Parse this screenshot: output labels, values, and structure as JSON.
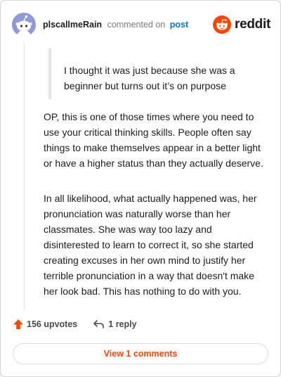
{
  "comment": {
    "username": "plscallmeRain",
    "action_text": "commented on",
    "post_link": "post",
    "quote": "I thought it was just because she was a beginner but turns out it’s on purpose",
    "paragraphs": [
      "OP, this is one of those times where you need to use your critical thinking skills. People often say things to make themselves appear in a better light or have a higher status than they actually deserve.",
      "In all likelihood, what actually happened was, her pronunciation was naturally worse than her classmates. She was way too lazy and disinterested to learn to correct it, so she started creating excuses in her own mind to justify her terrible pronunciation in a way that doesn't make her look bad. This has nothing to do with you."
    ]
  },
  "brand": {
    "name": "reddit",
    "icon": "reddit-logo-icon",
    "color": "#ff4500"
  },
  "actions": {
    "upvotes": "156 upvotes",
    "upvote_icon": "upvote-arrow-icon",
    "replies": "1 reply",
    "reply_icon": "reply-arrow-icon"
  },
  "view_comments": "View 1 comments",
  "colors": {
    "accent": "#ff4500",
    "link": "#0079d3",
    "avatar_bg": "#8f99d8"
  }
}
